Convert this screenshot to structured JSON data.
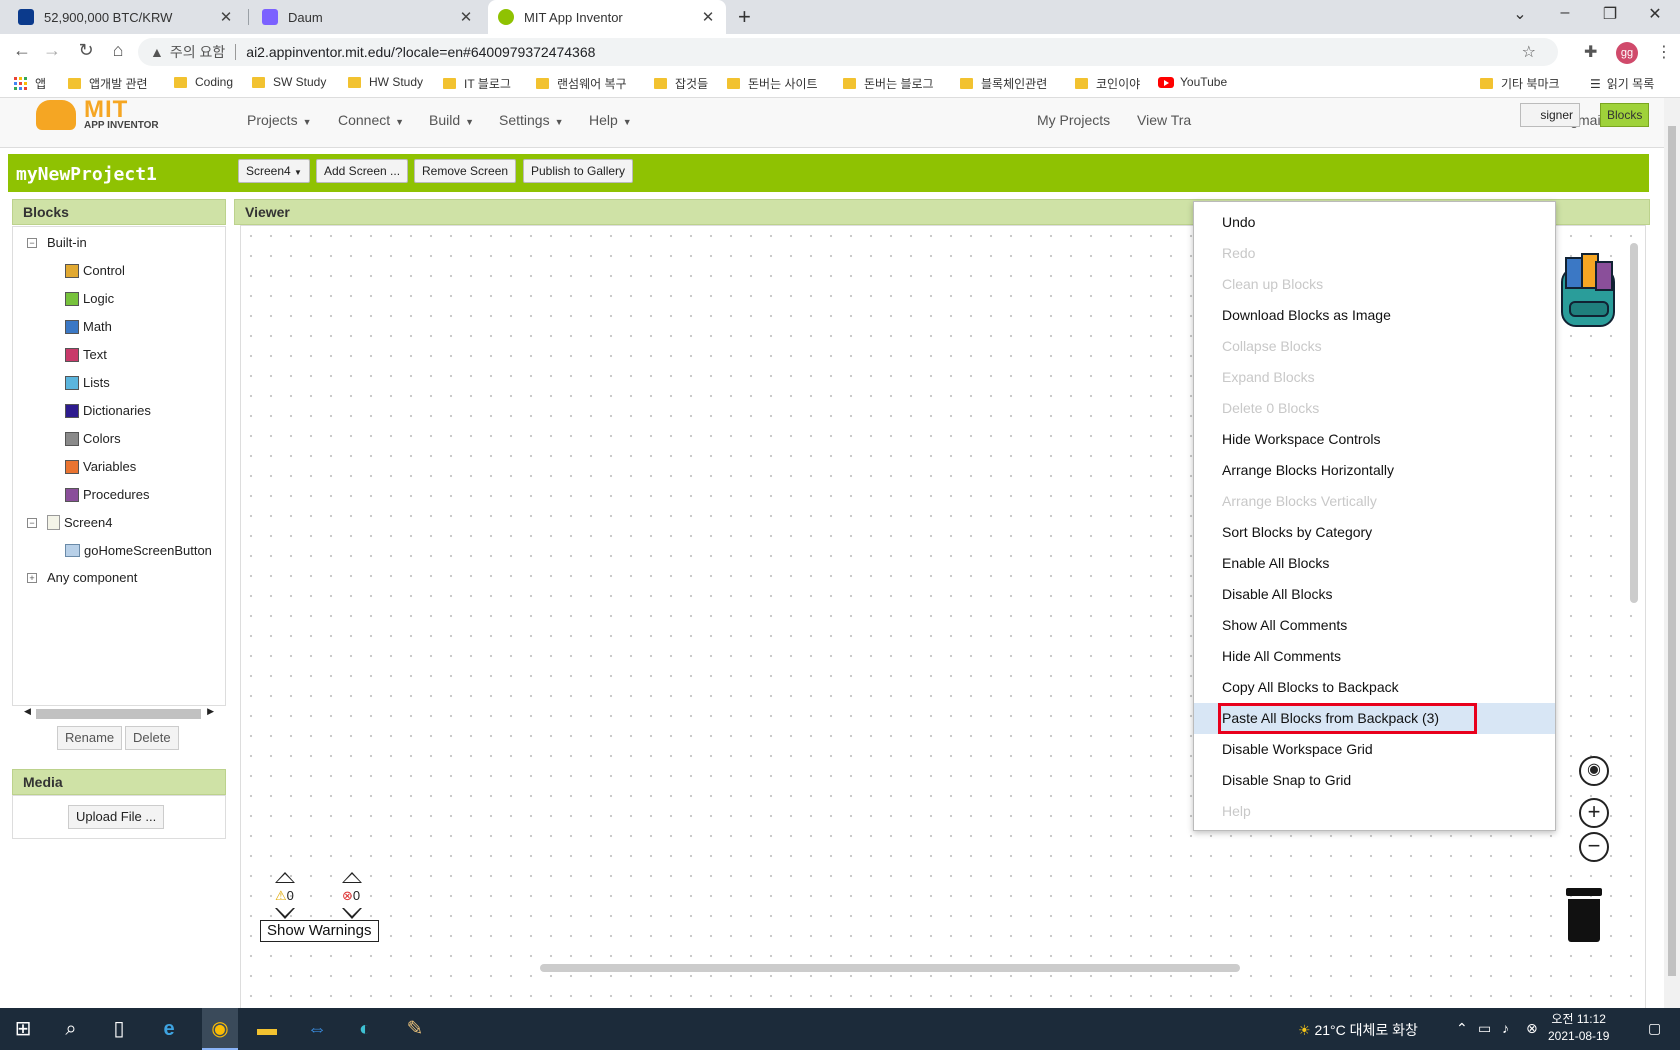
{
  "browser": {
    "tabs": [
      {
        "title": "52,900,000 BTC/KRW",
        "active": false
      },
      {
        "title": "Daum",
        "active": false
      },
      {
        "title": "MIT App Inventor",
        "active": true
      }
    ],
    "address": {
      "security_label": "주의 요함",
      "url": "ai2.appinventor.mit.edu/?locale=en#6400979372474368"
    },
    "profile_initials": "gg",
    "bookmarks": [
      "앱",
      "앱개발 관련",
      "Coding",
      "SW Study",
      "HW Study",
      "IT 블로그",
      "랜섬웨어 복구",
      "잡것들",
      "돈버는 사이트",
      "돈버는 블로그",
      "블록체인관련",
      "코인이야",
      "YouTube"
    ],
    "bookmarks_right": [
      "기타 북마크",
      "읽기 목록"
    ]
  },
  "app": {
    "logo_title": "MIT",
    "logo_subtitle": "APP INVENTOR",
    "menu": [
      "Projects",
      "Connect",
      "Build",
      "Settings",
      "Help"
    ],
    "right_links": [
      "My Projects",
      "View Tra"
    ],
    "account_suffix": "@gmail.com",
    "project_name": "myNewProject1",
    "project_buttons": [
      "Screen4",
      "Add Screen ...",
      "Remove Screen",
      "Publish to Gallery"
    ],
    "designer_label": "signer",
    "blocks_label": "Blocks"
  },
  "blocks_panel": {
    "title": "Blocks",
    "builtin_label": "Built-in",
    "builtin": [
      {
        "label": "Control",
        "color": "#e1a932"
      },
      {
        "label": "Logic",
        "color": "#77c23c"
      },
      {
        "label": "Math",
        "color": "#3b78c5"
      },
      {
        "label": "Text",
        "color": "#c83a6a"
      },
      {
        "label": "Lists",
        "color": "#5bb5dd"
      },
      {
        "label": "Dictionaries",
        "color": "#2d1b8e"
      },
      {
        "label": "Colors",
        "color": "#8a8a8a"
      },
      {
        "label": "Variables",
        "color": "#ea7431"
      },
      {
        "label": "Procedures",
        "color": "#8a4f9a"
      }
    ],
    "screen_label": "Screen4",
    "component_label": "goHomeScreenButton",
    "any_component_label": "Any component",
    "rename_label": "Rename",
    "delete_label": "Delete"
  },
  "media_panel": {
    "title": "Media",
    "upload_label": "Upload File ..."
  },
  "viewer": {
    "title": "Viewer",
    "warnings_count": "0",
    "errors_count": "0",
    "show_warnings_label": "Show Warnings"
  },
  "context_menu": {
    "items": [
      {
        "label": "Undo",
        "enabled": true
      },
      {
        "label": "Redo",
        "enabled": false
      },
      {
        "label": "Clean up Blocks",
        "enabled": false
      },
      {
        "label": "Download Blocks as Image",
        "enabled": true
      },
      {
        "label": "Collapse Blocks",
        "enabled": false
      },
      {
        "label": "Expand Blocks",
        "enabled": false
      },
      {
        "label": "Delete 0 Blocks",
        "enabled": false
      },
      {
        "label": "Hide Workspace Controls",
        "enabled": true
      },
      {
        "label": "Arrange Blocks Horizontally",
        "enabled": true
      },
      {
        "label": "Arrange Blocks Vertically",
        "enabled": false
      },
      {
        "label": "Sort Blocks by Category",
        "enabled": true
      },
      {
        "label": "Enable All Blocks",
        "enabled": true
      },
      {
        "label": "Disable All Blocks",
        "enabled": true
      },
      {
        "label": "Show All Comments",
        "enabled": true
      },
      {
        "label": "Hide All Comments",
        "enabled": true
      },
      {
        "label": "Copy All Blocks to Backpack",
        "enabled": true
      },
      {
        "label": "Paste All Blocks from Backpack (3)",
        "enabled": true,
        "highlighted": true
      },
      {
        "label": "Disable Workspace Grid",
        "enabled": true
      },
      {
        "label": "Disable Snap to Grid",
        "enabled": true
      },
      {
        "label": "Help",
        "enabled": false
      }
    ]
  },
  "taskbar": {
    "weather": "21°C 대체로 화창",
    "time": "오전 11:12",
    "date": "2021-08-19"
  },
  "colors": {
    "accent_green": "#8fc202",
    "highlight_border": "#e8001c"
  }
}
